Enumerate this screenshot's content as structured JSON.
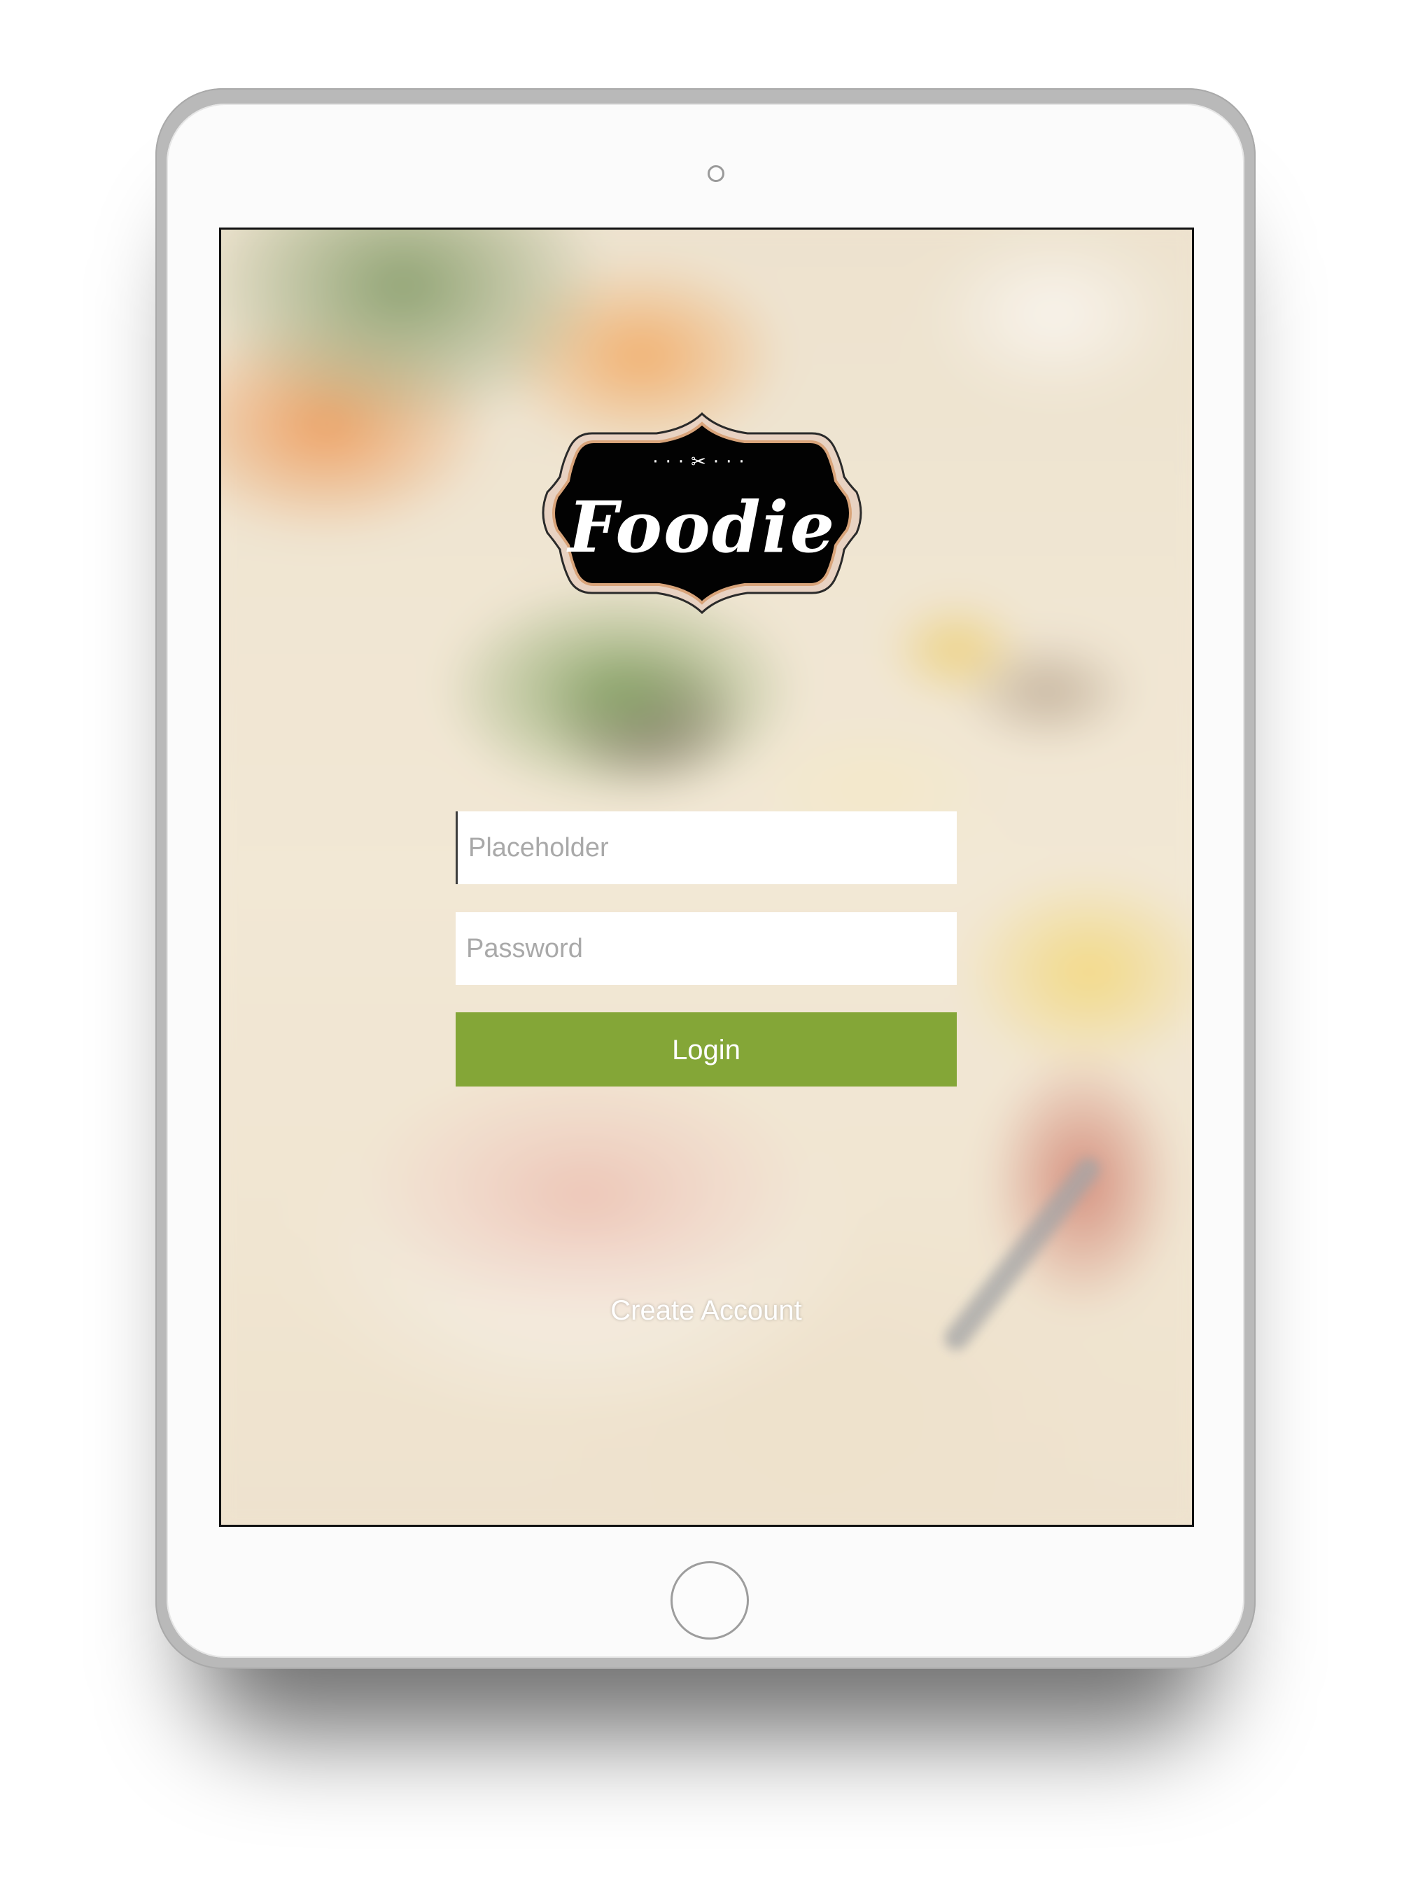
{
  "app": {
    "brand": "Foodie",
    "brand_ornament": "···✂···"
  },
  "login_form": {
    "username_placeholder": "Placeholder",
    "password_placeholder": "Password",
    "login_label": "Login",
    "create_account_label": "Create Account"
  },
  "colors": {
    "login_button": "#84a637",
    "logo_background": "#000000",
    "logo_border": "#d9a47a",
    "device_frame": "#b9b9b9"
  },
  "icons": {
    "logo_emblem": "fork-and-knife-icon"
  }
}
